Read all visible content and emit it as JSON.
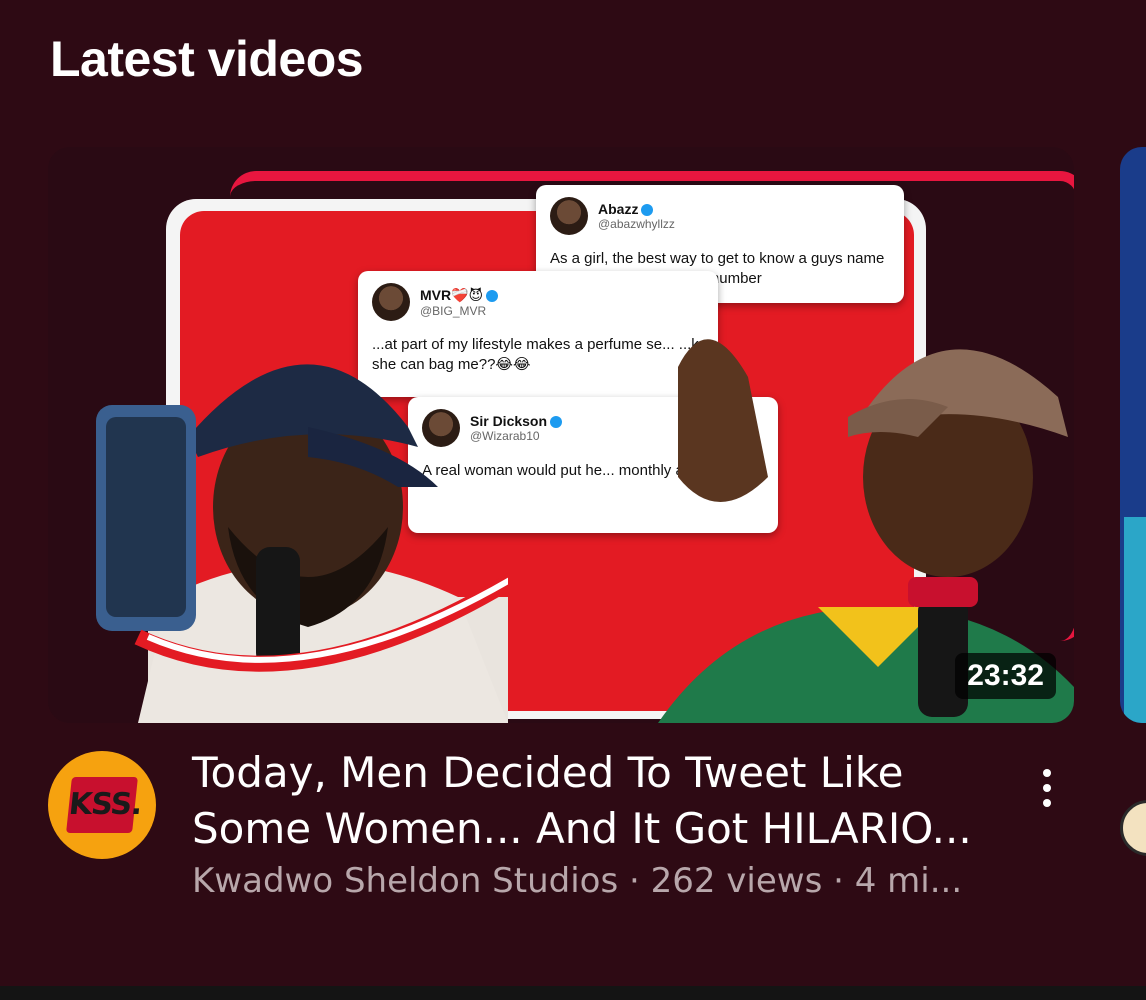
{
  "section": {
    "title": "Latest videos"
  },
  "video": {
    "title": "Today, Men Decided To Tweet Like Some Women... And It Got HILARIO...",
    "meta": "Kwadwo Sheldon Studios · 262 views · 4 mi...",
    "duration": "23:32",
    "channel_logo_text": "KSS.",
    "thumbnail": {
      "tweets": [
        {
          "name": "Abazz",
          "handle": "@abazwhyllzz",
          "text": "As a girl, the best way to get to know a guys name is to ask for his account number"
        },
        {
          "name": "MVR❤️‍🩹😈",
          "handle": "@BIG_MVR",
          "text": "...at part of my lifestyle makes a perfume se... ...k she can bag me??😂😂"
        },
        {
          "name": "Sir Dickson",
          "handle": "@Wizarab10",
          "text": "A real woman would put he... monthly allowance..."
        }
      ]
    }
  },
  "colors": {
    "background": "#2e0a14",
    "accent_red": "#e31b23",
    "channel_avatar_bg": "#f6a20f",
    "meta_text": "#b8a7ab"
  },
  "icons": {
    "more": "more-vertical-icon",
    "verified": "verified-badge-icon"
  }
}
